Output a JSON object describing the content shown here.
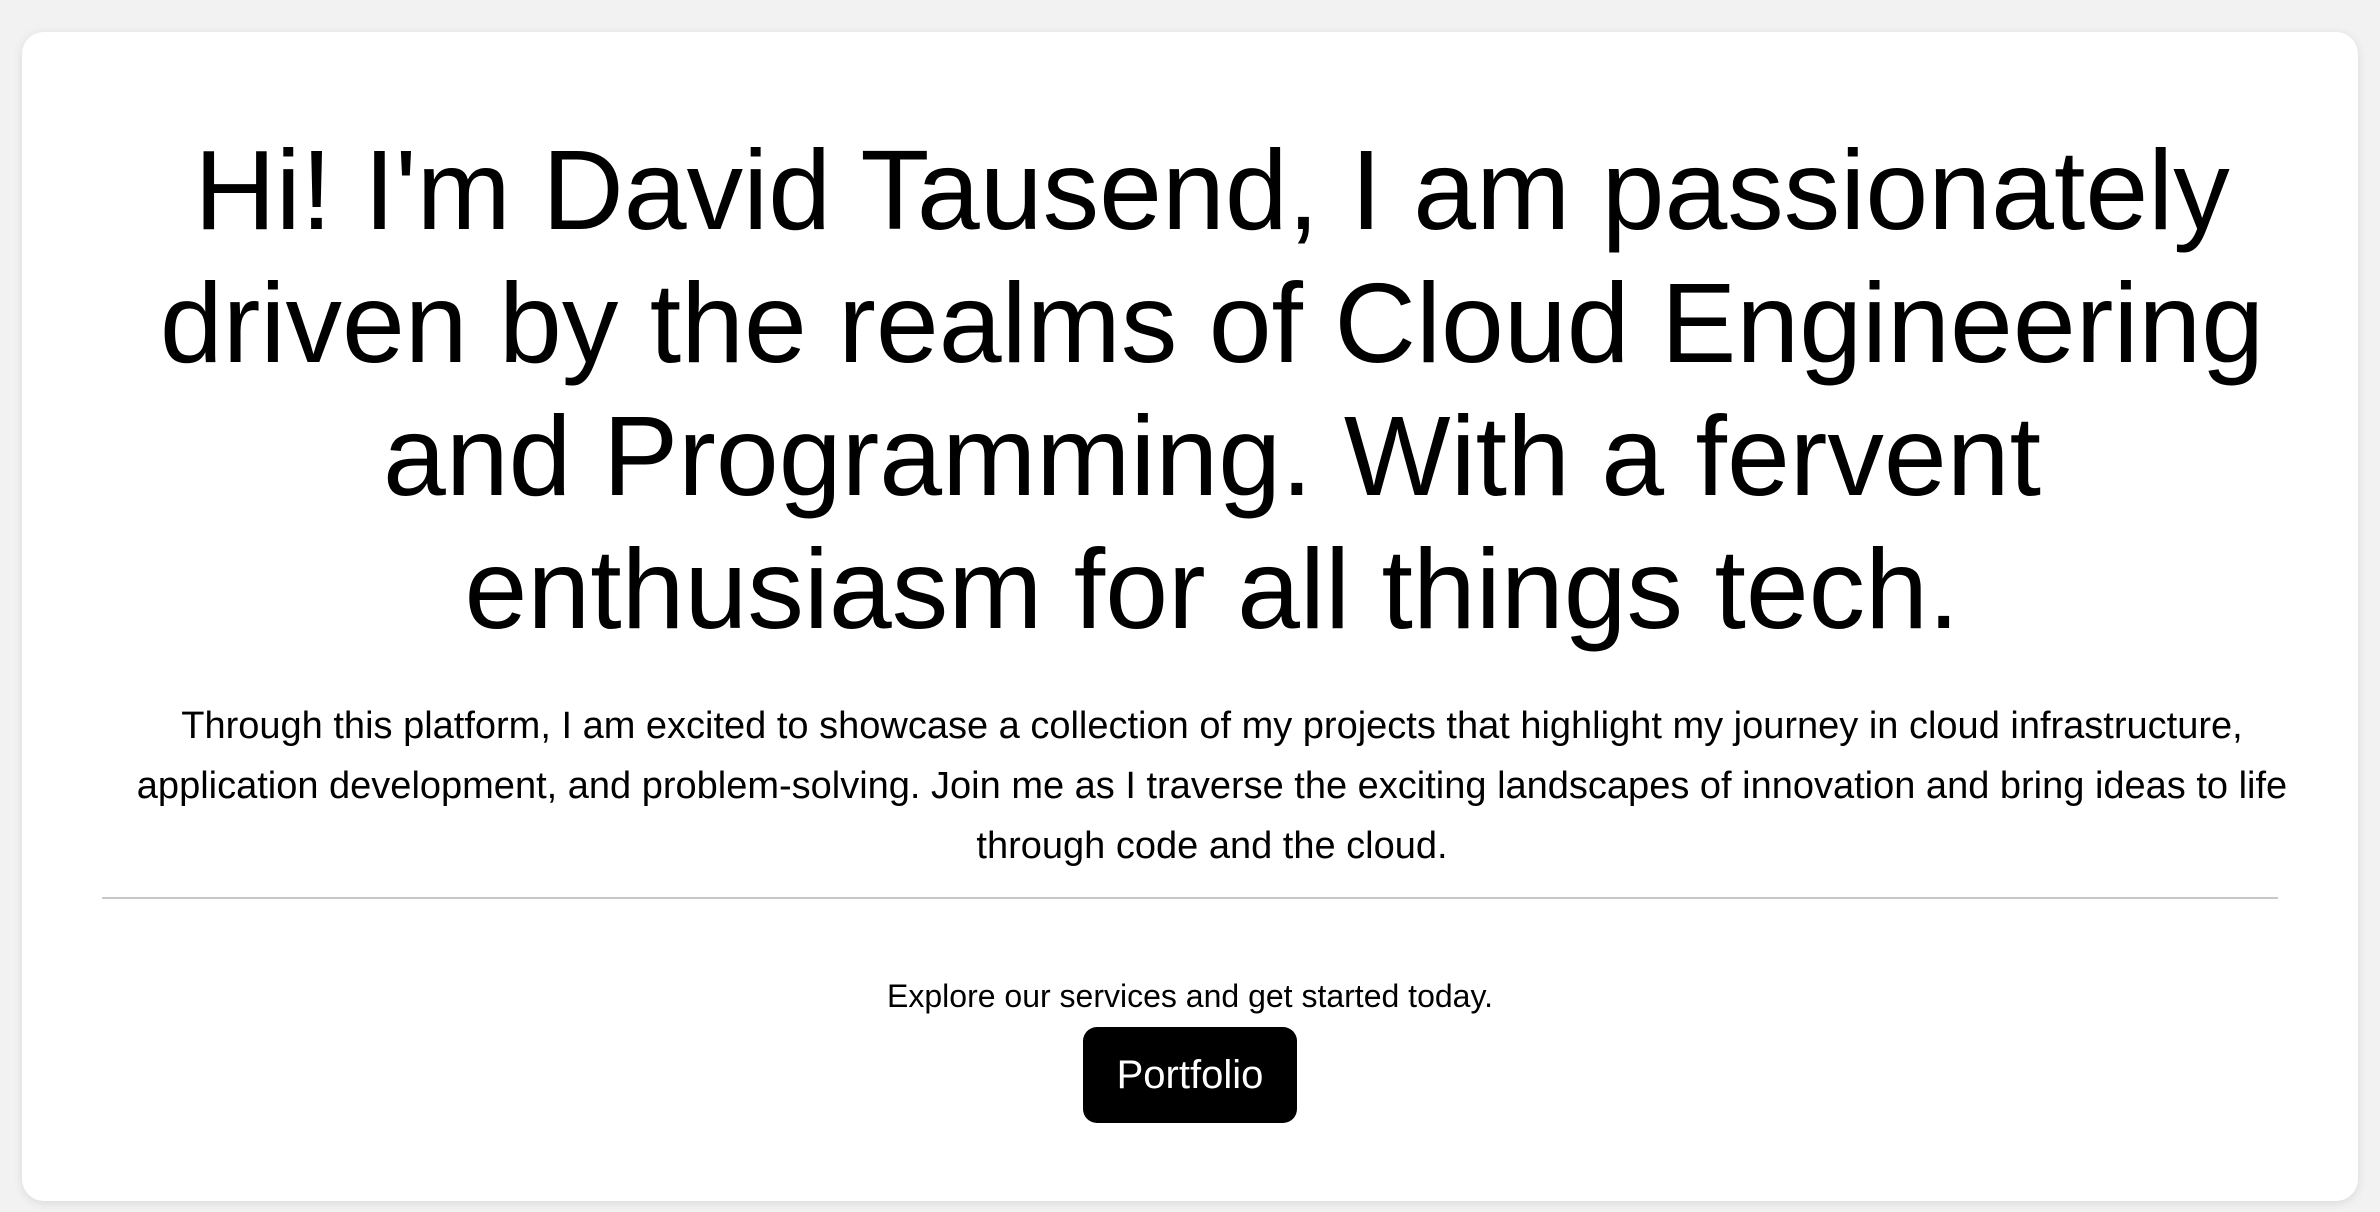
{
  "hero": {
    "headline": "Hi! I'm David Tausend, I am passionately driven by the realms of Cloud Engineering and Programming. With a fervent enthusiasm for all things tech.",
    "intro": "Through this platform, I am excited to showcase a collection of my projects that highlight my journey in cloud infrastructure, application development, and problem-solving. Join me as I traverse the exciting landscapes of innovation and bring ideas to life through code and the cloud."
  },
  "cta": {
    "text": "Explore our services and get started today.",
    "button_label": "Portfolio"
  },
  "colors": {
    "page_background": "#f2f2f2",
    "card_background": "#ffffff",
    "text": "#000000",
    "button_background": "#000000",
    "button_text": "#ffffff",
    "divider": "#c8c8c8"
  }
}
